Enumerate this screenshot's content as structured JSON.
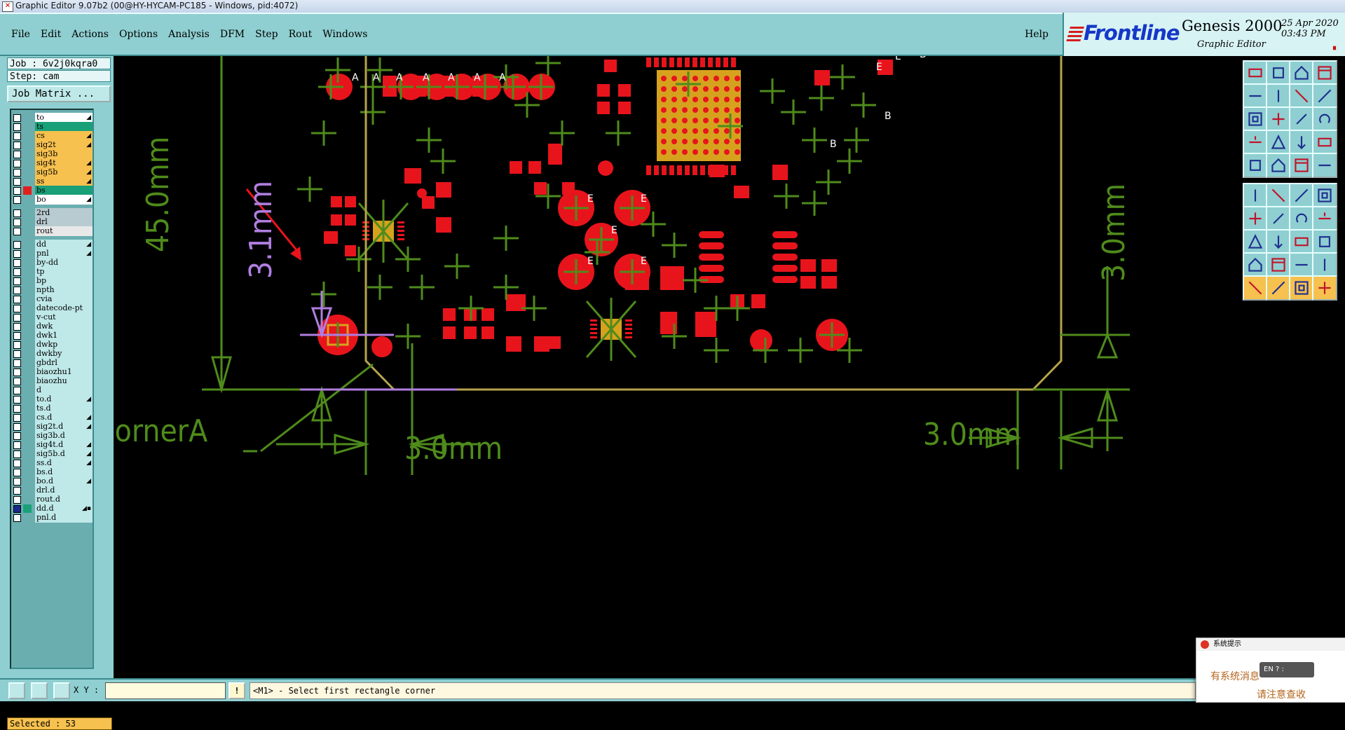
{
  "window": {
    "title": "Graphic Editor 9.07b2 (00@HY-HYCAM-PC185 - Windows, pid:4072)"
  },
  "menubar": {
    "items": [
      "File",
      "Edit",
      "Actions",
      "Options",
      "Analysis",
      "DFM",
      "Step",
      "Rout",
      "Windows"
    ],
    "help": "Help"
  },
  "brand": {
    "logo": "Frontline",
    "product": "Genesis 2000",
    "subtitle": "Graphic Editor",
    "date_line1": "25 Apr 2020",
    "date_line2": "03:43 PM",
    "rec_symbol": "⏸"
  },
  "job": {
    "job_label": "Job : 6v2j0kqra0",
    "step_label": "Step: cam",
    "matrix_button": "Job Matrix ..."
  },
  "layers": [
    {
      "name": "to",
      "color": "#ffffff",
      "flag": "◢"
    },
    {
      "name": "ts",
      "color": "#1aa079",
      "flag": ""
    },
    {
      "name": "cs",
      "color": "#f6c14e",
      "flag": "◢"
    },
    {
      "name": "sig2t",
      "color": "#f6c14e",
      "flag": "◢"
    },
    {
      "name": "sig3b",
      "color": "#f6c14e",
      "flag": ""
    },
    {
      "name": "sig4t",
      "color": "#f6c14e",
      "flag": "◢"
    },
    {
      "name": "sig5b",
      "color": "#f6c14e",
      "flag": "◢"
    },
    {
      "name": "ss",
      "color": "#f6c14e",
      "flag": "◢"
    },
    {
      "name": "bs",
      "color": "#1aa079",
      "flag": "",
      "mark": "#e0201e"
    },
    {
      "name": "bo",
      "color": "#ffffff",
      "flag": "◢"
    },
    {
      "name": "2rd",
      "color": "#b8cbd0",
      "flag": ""
    },
    {
      "name": "drl",
      "color": "#b8cbd0",
      "flag": ""
    },
    {
      "name": "rout",
      "color": "#e8e8e8",
      "flag": ""
    },
    {
      "name": "dd",
      "color": "#bfe8e8",
      "flag": "◢"
    },
    {
      "name": "pnl",
      "color": "#bfe8e8",
      "flag": "◢"
    },
    {
      "name": "by-dd",
      "color": "#bfe8e8",
      "flag": ""
    },
    {
      "name": "tp",
      "color": "#bfe8e8",
      "flag": ""
    },
    {
      "name": "bp",
      "color": "#bfe8e8",
      "flag": ""
    },
    {
      "name": "npth",
      "color": "#bfe8e8",
      "flag": ""
    },
    {
      "name": "cvia",
      "color": "#bfe8e8",
      "flag": ""
    },
    {
      "name": "datecode-pt",
      "color": "#bfe8e8",
      "flag": ""
    },
    {
      "name": "v-cut",
      "color": "#bfe8e8",
      "flag": ""
    },
    {
      "name": "dwk",
      "color": "#bfe8e8",
      "flag": ""
    },
    {
      "name": "dwk1",
      "color": "#bfe8e8",
      "flag": ""
    },
    {
      "name": "dwkp",
      "color": "#bfe8e8",
      "flag": ""
    },
    {
      "name": "dwkby",
      "color": "#bfe8e8",
      "flag": ""
    },
    {
      "name": "gbdrl",
      "color": "#bfe8e8",
      "flag": ""
    },
    {
      "name": "biaozhu1",
      "color": "#bfe8e8",
      "flag": ""
    },
    {
      "name": "biaozhu",
      "color": "#bfe8e8",
      "flag": ""
    },
    {
      "name": "d",
      "color": "#bfe8e8",
      "flag": ""
    },
    {
      "name": "to.d",
      "color": "#bfe8e8",
      "flag": "◢"
    },
    {
      "name": "ts.d",
      "color": "#bfe8e8",
      "flag": ""
    },
    {
      "name": "cs.d",
      "color": "#bfe8e8",
      "flag": "◢"
    },
    {
      "name": "sig2t.d",
      "color": "#bfe8e8",
      "flag": "◢"
    },
    {
      "name": "sig3b.d",
      "color": "#bfe8e8",
      "flag": ""
    },
    {
      "name": "sig4t.d",
      "color": "#bfe8e8",
      "flag": "◢"
    },
    {
      "name": "sig5b.d",
      "color": "#bfe8e8",
      "flag": "◢"
    },
    {
      "name": "ss.d",
      "color": "#bfe8e8",
      "flag": "◢"
    },
    {
      "name": "bs.d",
      "color": "#bfe8e8",
      "flag": ""
    },
    {
      "name": "bo.d",
      "color": "#bfe8e8",
      "flag": "◢"
    },
    {
      "name": "drl.d",
      "color": "#bfe8e8",
      "flag": ""
    },
    {
      "name": "rout.d",
      "color": "#bfe8e8",
      "flag": ""
    },
    {
      "name": "dd.d",
      "color": "#bfe8e8",
      "flag": "◢▪",
      "mark": "#1aa079",
      "checked": true
    },
    {
      "name": "pnl.d",
      "color": "#bfe8e8",
      "flag": ""
    }
  ],
  "selected": "Selected : 53",
  "canvas": {
    "annotations": {
      "height_45": "45.0mm",
      "height_31": "3.1mm",
      "height_30_right": "3.0mm",
      "width_30_bottom": "3.0mm",
      "width_30_right": "3.0mm",
      "corner_label": "CornerA"
    },
    "pad_letters": [
      "A",
      "A",
      "A",
      "A",
      "A",
      "A",
      "A",
      "E",
      "E",
      "E",
      "E",
      "E",
      "E",
      "E",
      "B",
      "B",
      "B"
    ]
  },
  "toolbar_icons": [
    "layer-up-icon",
    "layer-down-icon",
    "home-icon",
    "window-icon",
    "prev-icon",
    "next-icon",
    "zoom-in-icon",
    "zoom-home-icon",
    "fit-icon",
    "pan-icon",
    "scale-icon",
    "help-icon",
    "snap-icon",
    "measure-icon",
    "grid-icon",
    "filter-icon",
    "pad-icon",
    "line-icon",
    "ruler-icon",
    "circle-icon",
    "node-icon",
    "rotate-icon",
    "arc-icon",
    "surface-icon",
    "slope-icon",
    "diag-icon",
    "curve-icon",
    "text-icon",
    "rect-icon",
    "minus-icon",
    "box-icon",
    "cube-icon",
    "triangle-icon",
    "tri2-icon",
    "tri3-icon",
    "tri4-icon",
    "pointer-icon",
    "pointer-alt-icon",
    "select-icon",
    "edit-icon"
  ],
  "statusbar": {
    "xy_label": "X Y :",
    "xy_value": "",
    "prompt": "<M1> - Select first rectangle corner",
    "excl": "!"
  },
  "popup": {
    "title": "系统提示",
    "line1": "有系统消息",
    "line2": "请注意查收",
    "ime": "EN ? :"
  },
  "colors": {
    "panel": "#8fcfd1",
    "pad_red": "#e8141c",
    "outline_gold": "#b5a44a",
    "dim_green": "#4f8b1b",
    "dim_violet": "#b07ee0"
  }
}
